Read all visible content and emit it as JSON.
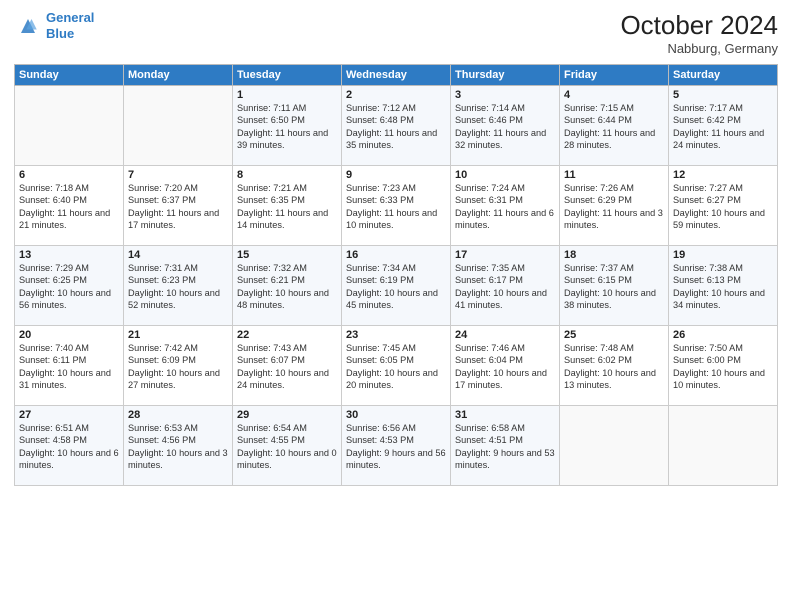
{
  "header": {
    "logo_line1": "General",
    "logo_line2": "Blue",
    "month": "October 2024",
    "location": "Nabburg, Germany"
  },
  "weekdays": [
    "Sunday",
    "Monday",
    "Tuesday",
    "Wednesday",
    "Thursday",
    "Friday",
    "Saturday"
  ],
  "weeks": [
    [
      {
        "day": "",
        "sunrise": "",
        "sunset": "",
        "daylight": ""
      },
      {
        "day": "",
        "sunrise": "",
        "sunset": "",
        "daylight": ""
      },
      {
        "day": "1",
        "sunrise": "Sunrise: 7:11 AM",
        "sunset": "Sunset: 6:50 PM",
        "daylight": "Daylight: 11 hours and 39 minutes."
      },
      {
        "day": "2",
        "sunrise": "Sunrise: 7:12 AM",
        "sunset": "Sunset: 6:48 PM",
        "daylight": "Daylight: 11 hours and 35 minutes."
      },
      {
        "day": "3",
        "sunrise": "Sunrise: 7:14 AM",
        "sunset": "Sunset: 6:46 PM",
        "daylight": "Daylight: 11 hours and 32 minutes."
      },
      {
        "day": "4",
        "sunrise": "Sunrise: 7:15 AM",
        "sunset": "Sunset: 6:44 PM",
        "daylight": "Daylight: 11 hours and 28 minutes."
      },
      {
        "day": "5",
        "sunrise": "Sunrise: 7:17 AM",
        "sunset": "Sunset: 6:42 PM",
        "daylight": "Daylight: 11 hours and 24 minutes."
      }
    ],
    [
      {
        "day": "6",
        "sunrise": "Sunrise: 7:18 AM",
        "sunset": "Sunset: 6:40 PM",
        "daylight": "Daylight: 11 hours and 21 minutes."
      },
      {
        "day": "7",
        "sunrise": "Sunrise: 7:20 AM",
        "sunset": "Sunset: 6:37 PM",
        "daylight": "Daylight: 11 hours and 17 minutes."
      },
      {
        "day": "8",
        "sunrise": "Sunrise: 7:21 AM",
        "sunset": "Sunset: 6:35 PM",
        "daylight": "Daylight: 11 hours and 14 minutes."
      },
      {
        "day": "9",
        "sunrise": "Sunrise: 7:23 AM",
        "sunset": "Sunset: 6:33 PM",
        "daylight": "Daylight: 11 hours and 10 minutes."
      },
      {
        "day": "10",
        "sunrise": "Sunrise: 7:24 AM",
        "sunset": "Sunset: 6:31 PM",
        "daylight": "Daylight: 11 hours and 6 minutes."
      },
      {
        "day": "11",
        "sunrise": "Sunrise: 7:26 AM",
        "sunset": "Sunset: 6:29 PM",
        "daylight": "Daylight: 11 hours and 3 minutes."
      },
      {
        "day": "12",
        "sunrise": "Sunrise: 7:27 AM",
        "sunset": "Sunset: 6:27 PM",
        "daylight": "Daylight: 10 hours and 59 minutes."
      }
    ],
    [
      {
        "day": "13",
        "sunrise": "Sunrise: 7:29 AM",
        "sunset": "Sunset: 6:25 PM",
        "daylight": "Daylight: 10 hours and 56 minutes."
      },
      {
        "day": "14",
        "sunrise": "Sunrise: 7:31 AM",
        "sunset": "Sunset: 6:23 PM",
        "daylight": "Daylight: 10 hours and 52 minutes."
      },
      {
        "day": "15",
        "sunrise": "Sunrise: 7:32 AM",
        "sunset": "Sunset: 6:21 PM",
        "daylight": "Daylight: 10 hours and 48 minutes."
      },
      {
        "day": "16",
        "sunrise": "Sunrise: 7:34 AM",
        "sunset": "Sunset: 6:19 PM",
        "daylight": "Daylight: 10 hours and 45 minutes."
      },
      {
        "day": "17",
        "sunrise": "Sunrise: 7:35 AM",
        "sunset": "Sunset: 6:17 PM",
        "daylight": "Daylight: 10 hours and 41 minutes."
      },
      {
        "day": "18",
        "sunrise": "Sunrise: 7:37 AM",
        "sunset": "Sunset: 6:15 PM",
        "daylight": "Daylight: 10 hours and 38 minutes."
      },
      {
        "day": "19",
        "sunrise": "Sunrise: 7:38 AM",
        "sunset": "Sunset: 6:13 PM",
        "daylight": "Daylight: 10 hours and 34 minutes."
      }
    ],
    [
      {
        "day": "20",
        "sunrise": "Sunrise: 7:40 AM",
        "sunset": "Sunset: 6:11 PM",
        "daylight": "Daylight: 10 hours and 31 minutes."
      },
      {
        "day": "21",
        "sunrise": "Sunrise: 7:42 AM",
        "sunset": "Sunset: 6:09 PM",
        "daylight": "Daylight: 10 hours and 27 minutes."
      },
      {
        "day": "22",
        "sunrise": "Sunrise: 7:43 AM",
        "sunset": "Sunset: 6:07 PM",
        "daylight": "Daylight: 10 hours and 24 minutes."
      },
      {
        "day": "23",
        "sunrise": "Sunrise: 7:45 AM",
        "sunset": "Sunset: 6:05 PM",
        "daylight": "Daylight: 10 hours and 20 minutes."
      },
      {
        "day": "24",
        "sunrise": "Sunrise: 7:46 AM",
        "sunset": "Sunset: 6:04 PM",
        "daylight": "Daylight: 10 hours and 17 minutes."
      },
      {
        "day": "25",
        "sunrise": "Sunrise: 7:48 AM",
        "sunset": "Sunset: 6:02 PM",
        "daylight": "Daylight: 10 hours and 13 minutes."
      },
      {
        "day": "26",
        "sunrise": "Sunrise: 7:50 AM",
        "sunset": "Sunset: 6:00 PM",
        "daylight": "Daylight: 10 hours and 10 minutes."
      }
    ],
    [
      {
        "day": "27",
        "sunrise": "Sunrise: 6:51 AM",
        "sunset": "Sunset: 4:58 PM",
        "daylight": "Daylight: 10 hours and 6 minutes."
      },
      {
        "day": "28",
        "sunrise": "Sunrise: 6:53 AM",
        "sunset": "Sunset: 4:56 PM",
        "daylight": "Daylight: 10 hours and 3 minutes."
      },
      {
        "day": "29",
        "sunrise": "Sunrise: 6:54 AM",
        "sunset": "Sunset: 4:55 PM",
        "daylight": "Daylight: 10 hours and 0 minutes."
      },
      {
        "day": "30",
        "sunrise": "Sunrise: 6:56 AM",
        "sunset": "Sunset: 4:53 PM",
        "daylight": "Daylight: 9 hours and 56 minutes."
      },
      {
        "day": "31",
        "sunrise": "Sunrise: 6:58 AM",
        "sunset": "Sunset: 4:51 PM",
        "daylight": "Daylight: 9 hours and 53 minutes."
      },
      {
        "day": "",
        "sunrise": "",
        "sunset": "",
        "daylight": ""
      },
      {
        "day": "",
        "sunrise": "",
        "sunset": "",
        "daylight": ""
      }
    ]
  ]
}
